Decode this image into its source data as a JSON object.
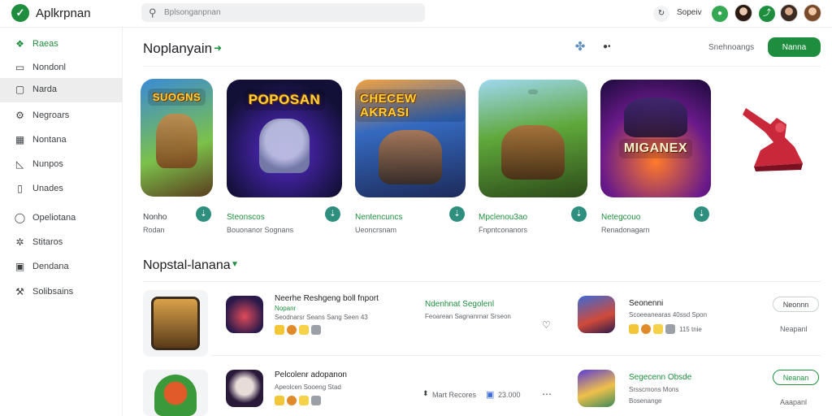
{
  "topbar": {
    "app_title": "Aplkrpnan",
    "search_placeholder": "Bplsonganpnan",
    "user_label": "Sopeiv"
  },
  "sidebar": {
    "items": [
      {
        "label": "Raeas",
        "icon": "leaf-icon"
      },
      {
        "label": "Nondonl",
        "icon": "box-icon"
      },
      {
        "label": "Narda",
        "icon": "square-icon"
      },
      {
        "label": "Negroars",
        "icon": "gear-icon"
      },
      {
        "label": "Nontana",
        "icon": "grid-icon"
      },
      {
        "label": "Nunpos",
        "icon": "chart-icon"
      },
      {
        "label": "Unades",
        "icon": "file-icon"
      },
      {
        "label": "Opeliotana",
        "icon": "circle-icon"
      },
      {
        "label": "Stitaros",
        "icon": "settings-icon"
      },
      {
        "label": "Dendana",
        "icon": "folder-icon"
      },
      {
        "label": "Solibsains",
        "icon": "wrench-icon"
      }
    ]
  },
  "header": {
    "title": "Noplanyain",
    "link": "Snehnoangs",
    "button": "Nanna"
  },
  "featured": [
    {
      "art_text": "SUOGNS",
      "name": "Nonho",
      "sub": "Rodan"
    },
    {
      "art_text": "POPOSAN",
      "name": "Steonscos",
      "sub": "Bouonanor Sognans"
    },
    {
      "art_text": "CHECEW AKRASI",
      "name": "Nentencuncs",
      "sub": "Ueoncrsnam"
    },
    {
      "art_text": "",
      "name": "Mpclenou3ao",
      "sub": "Fnpntconanors"
    },
    {
      "art_text": "MIGANEX",
      "name": "Netegcouo",
      "sub": "Renadonagarn"
    }
  ],
  "section2": {
    "title": "Nopstal-lanana",
    "row1": {
      "left_title": "Neerhe Reshgeng boll fnport",
      "left_sub1": "Nopanr",
      "left_sub2": "Seodnarsr Seans Sang Seen 43",
      "mid_title": "Ndenhnat Segolenl",
      "mid_sub": "Feoarean Sagnanrnar Srseon",
      "right_title": "Seonenni",
      "right_sub1": "Scoeeanearas 40ssd Spon",
      "right_sub2": "115 tnie",
      "btn_label": "Neonnn",
      "btn_sub": "Neapanl"
    },
    "row2": {
      "left_title": "Pelcolenr adopanon",
      "left_sub": "Apeolcen Sooeng Stad",
      "stat1": "Mart Recores",
      "stat2": "23.000",
      "right_title": "Segecenn Obsde",
      "right_sub1": "Srsscmons Mons",
      "right_sub2": "Bosenange",
      "btn_label": "Neanan",
      "btn_sub": "Aaapanl"
    }
  },
  "colors": {
    "accent": "#1e8e3e",
    "teal": "#2f8f7f"
  }
}
